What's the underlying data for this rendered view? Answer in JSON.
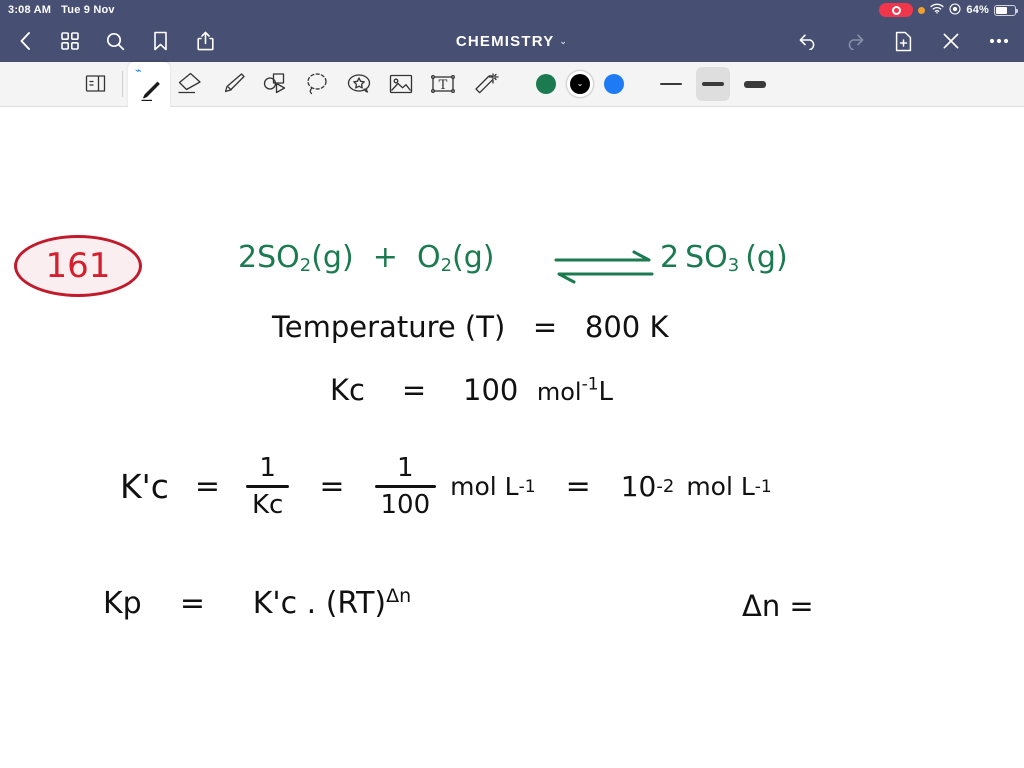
{
  "status_bar": {
    "time": "3:08 AM",
    "date": "Tue 9 Nov",
    "battery_percent": "64%",
    "icons": [
      "screen-recording-indicator",
      "orange-privacy-dot",
      "wifi-icon",
      "control-center-icon",
      "battery-icon"
    ]
  },
  "navbar": {
    "title": "CHEMISTRY",
    "title_chevron": "⌄",
    "left_icons": [
      {
        "name": "back-button",
        "label": "Back"
      },
      {
        "name": "thumbnails-button",
        "label": "Page Thumbnails"
      },
      {
        "name": "search-button",
        "label": "Search"
      },
      {
        "name": "bookmark-button",
        "label": "Bookmark"
      },
      {
        "name": "share-button",
        "label": "Share"
      }
    ],
    "right_icons": [
      {
        "name": "undo-button",
        "label": "Undo"
      },
      {
        "name": "redo-button",
        "label": "Redo"
      },
      {
        "name": "add-page-button",
        "label": "Add Page"
      },
      {
        "name": "close-button",
        "label": "Close"
      },
      {
        "name": "more-button",
        "label": "More"
      }
    ]
  },
  "toolbar": {
    "tools": [
      {
        "name": "page-layers-tool",
        "label": "Page"
      },
      {
        "name": "pen-tool",
        "label": "Pen",
        "selected": true,
        "bluetooth": "⌁"
      },
      {
        "name": "eraser-tool",
        "label": "Eraser",
        "selected": false
      },
      {
        "name": "highlighter-tool",
        "label": "Highlighter",
        "selected": false
      },
      {
        "name": "shapes-tool",
        "label": "Shapes",
        "selected": false
      },
      {
        "name": "lasso-tool",
        "label": "Lasso Select",
        "selected": false
      },
      {
        "name": "sticker-tool",
        "label": "Sticker",
        "selected": false
      },
      {
        "name": "image-tool",
        "label": "Image",
        "selected": false
      },
      {
        "name": "text-tool",
        "label": "Text Box",
        "selected": false
      },
      {
        "name": "magic-wand-tool",
        "label": "Magic Wand",
        "selected": false
      }
    ],
    "colors": [
      {
        "name": "color-green",
        "hex": "#1B7A50",
        "selected": false
      },
      {
        "name": "color-black",
        "hex": "#000000",
        "selected": true
      },
      {
        "name": "color-blue",
        "hex": "#1F7AF5",
        "selected": false
      }
    ],
    "widths": [
      {
        "name": "width-thin",
        "selected": false
      },
      {
        "name": "width-medium",
        "selected": true
      },
      {
        "name": "width-thick",
        "selected": false
      }
    ]
  },
  "canvas": {
    "problem_number": "161",
    "equation": {
      "reactant_1_coeff": "2",
      "reactant_1": "SO",
      "reactant_1_sub": "2",
      "reactant_1_state": "(g)",
      "plus": "+",
      "reactant_2": "O",
      "reactant_2_sub": "2",
      "reactant_2_state": "(g)",
      "product_coeff": "2",
      "product": "SO",
      "product_sub": "3",
      "product_state": "(g)"
    },
    "lines": {
      "temperature_label": "Temperature (T)",
      "temperature_eq": "=",
      "temperature_value": "800 K",
      "kc_label": "Kc",
      "kc_eq": "=",
      "kc_value": "100",
      "kc_unit_base": "mol",
      "kc_unit_sup": "-1",
      "kc_unit_tail": "L",
      "kcp_symbol": "K'c",
      "eq1": "=",
      "frac1_num": "1",
      "frac1_den": "Kc",
      "eq2": "=",
      "frac2_num": "1",
      "frac2_den": "100",
      "unit2_base": "mol L",
      "unit2_sup": "-1",
      "eq3": "=",
      "power_base": "10",
      "power_sup": "-2",
      "unit3_base": "mol L",
      "unit3_sup": "-1",
      "kp_symbol": "Kp",
      "eq4": "=",
      "kp_rhs": "K'c . (RT)",
      "kp_exp": "Δn",
      "delta_n": "Δn ="
    }
  }
}
